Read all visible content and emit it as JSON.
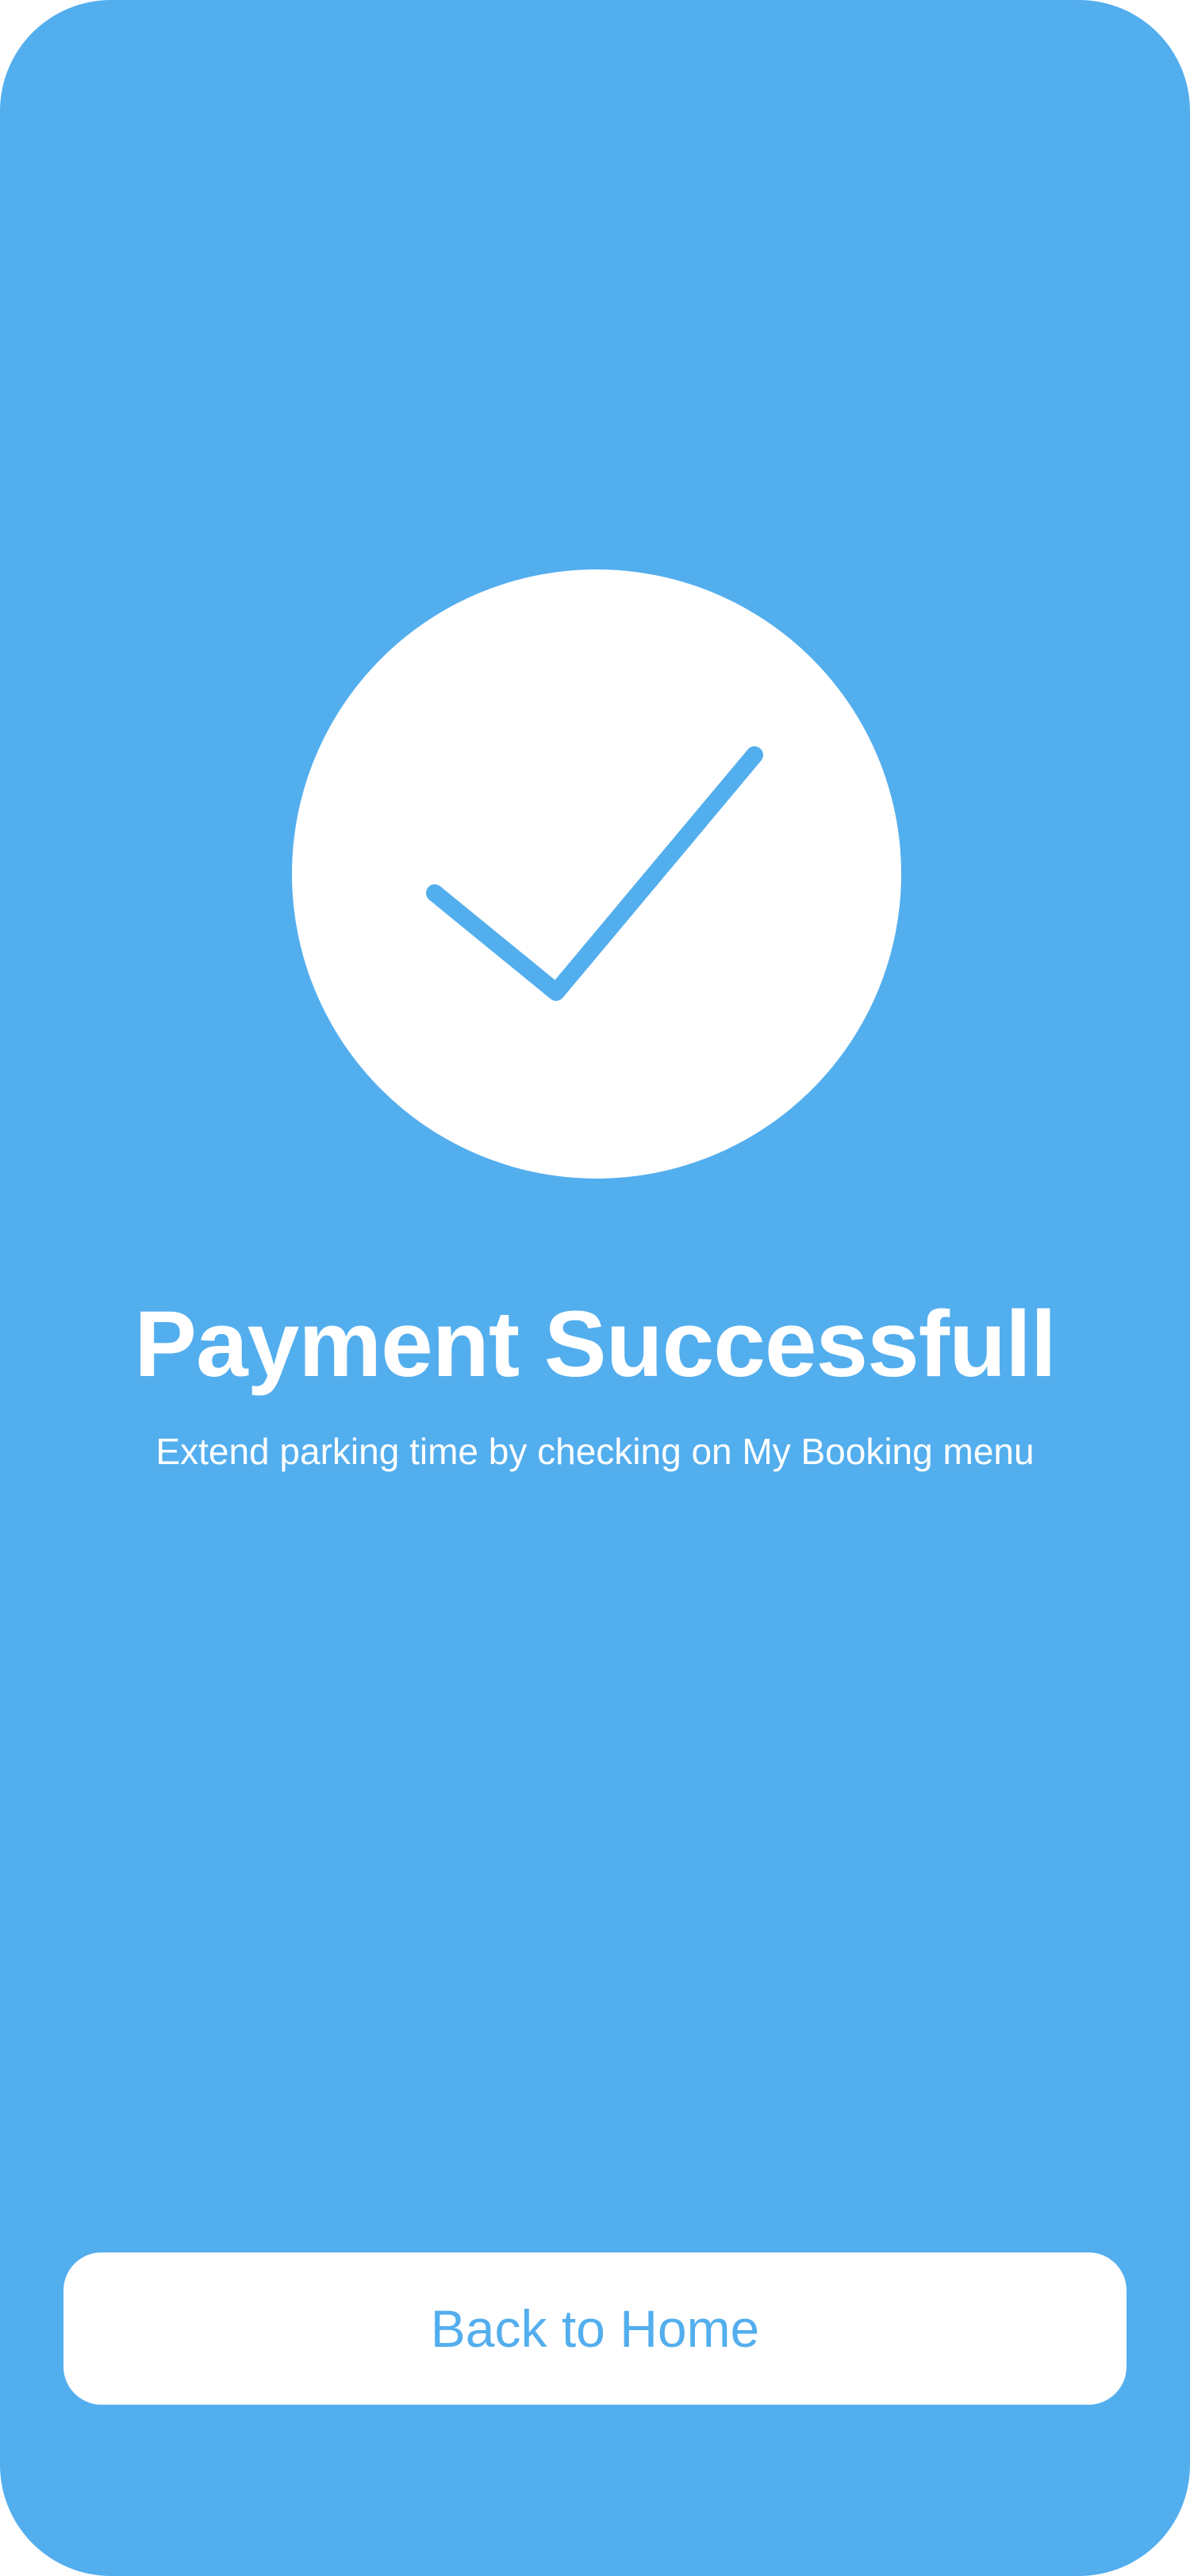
{
  "theme": {
    "background_color": "#53AEEE",
    "surface_color": "#FFFFFF",
    "accent_color": "#53AEEE"
  },
  "status": {
    "icon": "checkmark-icon",
    "title": "Payment Successfull",
    "message": "Extend parking time by checking on My Booking menu"
  },
  "actions": {
    "back_home_label": "Back to Home"
  }
}
